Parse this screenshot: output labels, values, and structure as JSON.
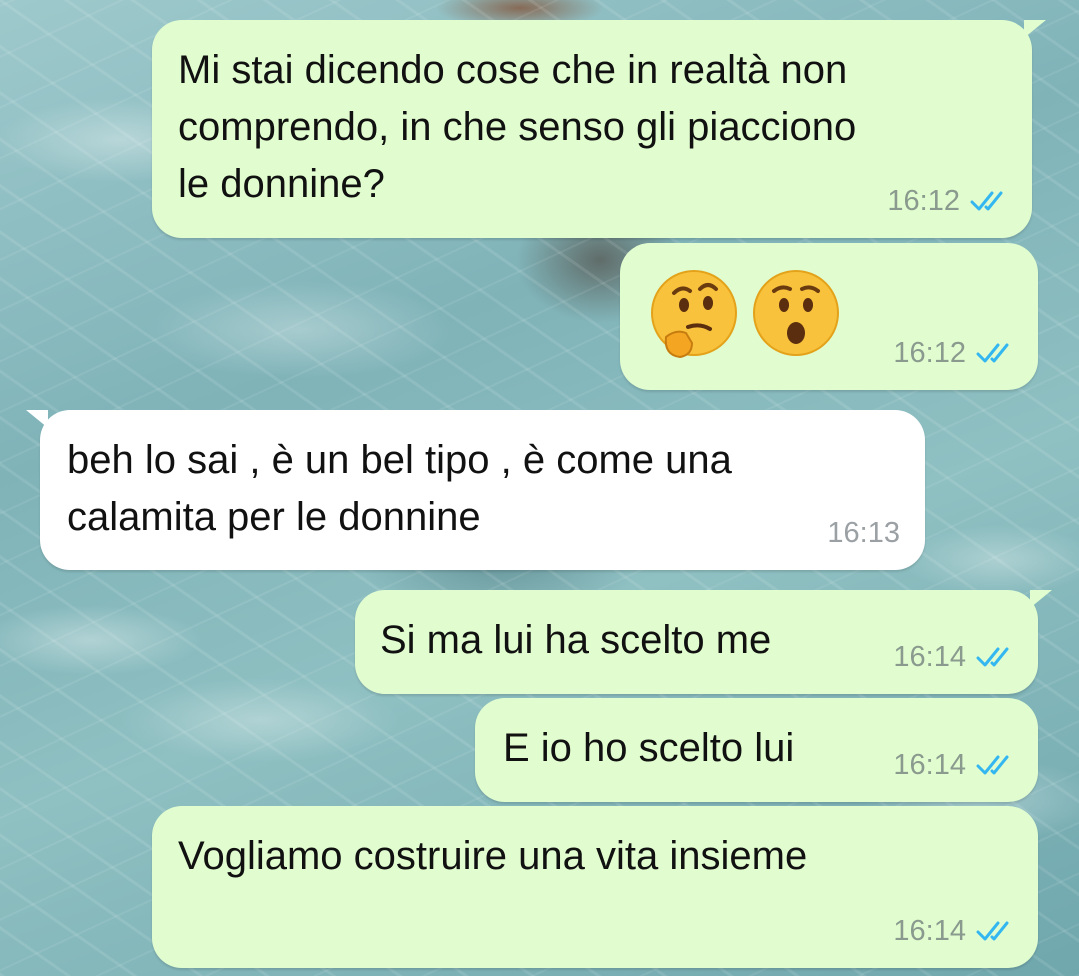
{
  "chat": {
    "colors": {
      "outgoing_bubble": "#e1fdcf",
      "incoming_bubble": "#ffffff",
      "read_ticks": "#34b7f1"
    },
    "messages": [
      {
        "direction": "outgoing",
        "text": "Mi stai dicendo cose che in realtà non\ncomprendo, in che senso gli piacciono\nle donnine?",
        "time": "16:12",
        "status": "read"
      },
      {
        "direction": "outgoing",
        "emojis": [
          "thinking-face-icon",
          "hushed-face-icon"
        ],
        "time": "16:12",
        "status": "read"
      },
      {
        "direction": "incoming",
        "text": "beh lo sai , è un bel tipo , è come una\ncalamita per le donnine",
        "time": "16:13"
      },
      {
        "direction": "outgoing",
        "text": "Si ma lui ha scelto me",
        "time": "16:14",
        "status": "read"
      },
      {
        "direction": "outgoing",
        "text": "E io ho scelto lui",
        "time": "16:14",
        "status": "read"
      },
      {
        "direction": "outgoing",
        "text": "Vogliamo costruire una vita insieme",
        "time": "16:14",
        "status": "read"
      }
    ]
  }
}
